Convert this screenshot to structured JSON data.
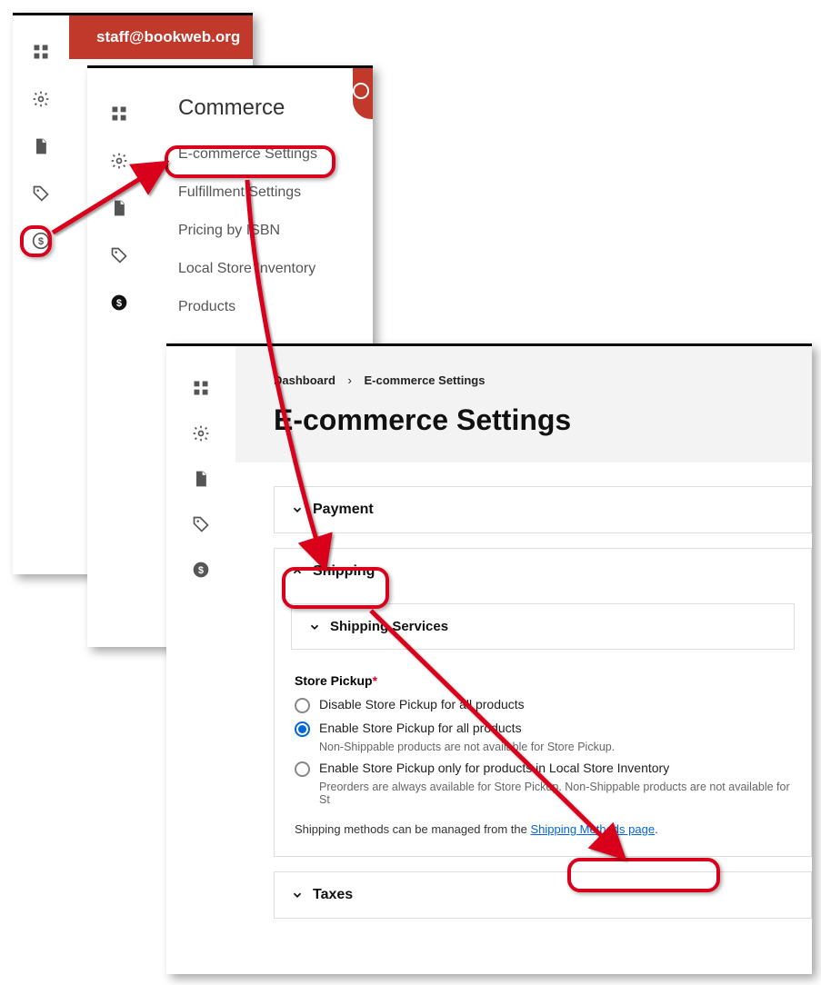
{
  "header": {
    "user_label": "staff@bookweb.org"
  },
  "commerce_menu": {
    "title": "Commerce",
    "items": [
      "E-commerce Settings",
      "Fulfillment Settings",
      "Pricing by ISBN",
      "Local Store Inventory",
      "Products"
    ]
  },
  "page": {
    "breadcrumb": {
      "root": "Dashboard",
      "separator": "›",
      "current": "E-commerce Settings"
    },
    "title": "E-commerce Settings",
    "sections": {
      "payment": {
        "label": "Payment"
      },
      "shipping": {
        "label": "Shipping",
        "subsection": {
          "label": "Shipping Services"
        },
        "store_pickup": {
          "label": "Store Pickup",
          "options": [
            {
              "text": "Disable Store Pickup for all products",
              "note": ""
            },
            {
              "text": "Enable Store Pickup for all products",
              "note": "Non-Shippable products are not available for Store Pickup."
            },
            {
              "text": "Enable Store Pickup only for products in Local Store Inventory",
              "note": "Preorders are always available for Store Pickup. Non-Shippable products are not available for St"
            }
          ],
          "selected": 1
        },
        "footnote_prefix": "Shipping methods can be managed from the ",
        "footnote_link": "Shipping Methods page",
        "footnote_suffix": "."
      },
      "taxes": {
        "label": "Taxes"
      }
    }
  },
  "sidebar_icons": [
    "dashboard-icon",
    "gear-icon",
    "page-icon",
    "tag-icon",
    "dollar-icon"
  ]
}
